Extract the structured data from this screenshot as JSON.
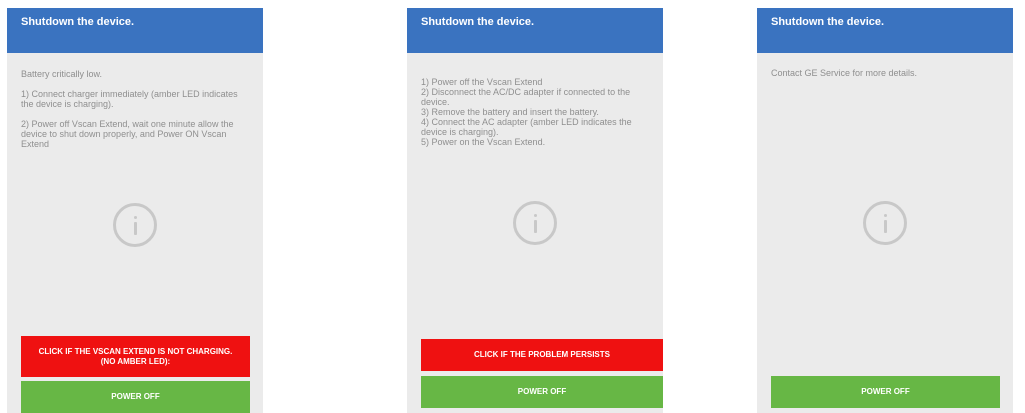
{
  "screens": [
    {
      "title": "Shutdown the device.",
      "message": "Battery critically low.\n\n1) Connect charger immediately (amber LED indicates the device is charging).\n\n2) Power off Vscan Extend, wait one minute allow the device to shut down properly, and Power ON Vscan Extend",
      "action_button": "CLICK IF THE VSCAN EXTEND IS NOT CHARGING.\n(NO AMBER LED):",
      "power_button": "POWER OFF"
    },
    {
      "title": "Shutdown the device.",
      "message": "1) Power off the Vscan Extend\n2) Disconnect the AC/DC adapter if connected to the device.\n3) Remove the battery and insert the battery.\n4) Connect the AC adapter (amber LED indicates the device is charging).\n5) Power on the Vscan Extend.",
      "action_button": "CLICK IF THE PROBLEM PERSISTS",
      "power_button": "POWER OFF"
    },
    {
      "title": "Shutdown the device.",
      "message": "Contact GE Service for more details.",
      "power_button": "POWER OFF"
    }
  ],
  "colors": {
    "header": "#3a73c0",
    "action_button": "#ef1111",
    "power_button": "#67b745",
    "background": "#ebebeb"
  },
  "icons": [
    "info-icon"
  ]
}
